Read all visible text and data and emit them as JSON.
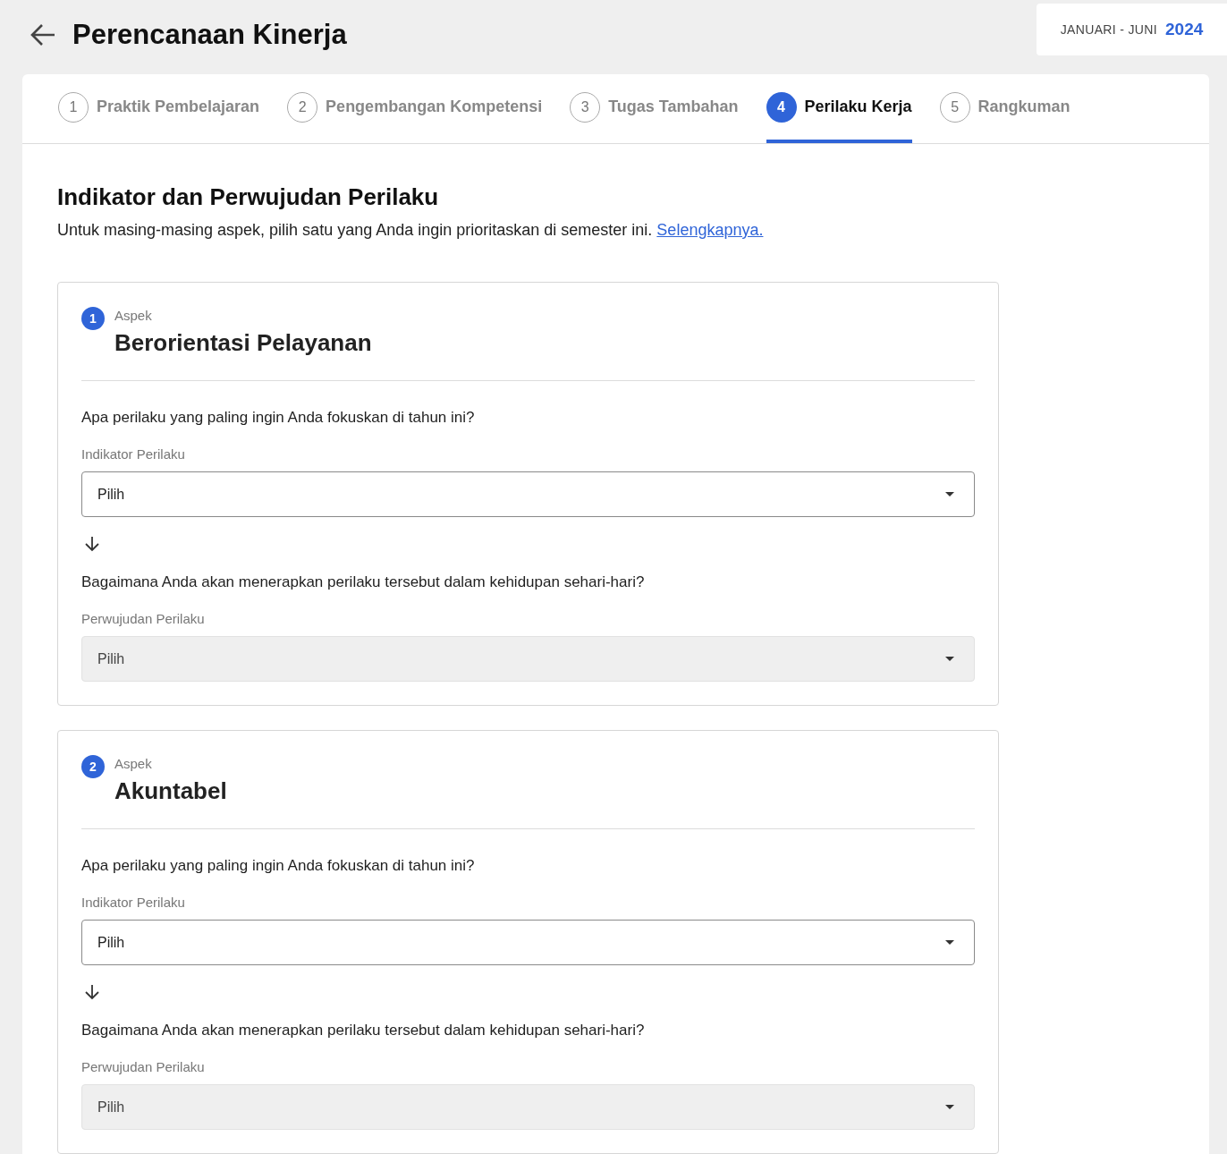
{
  "header": {
    "title": "Perencanaan Kinerja",
    "period": {
      "range": "JANUARI - JUNI",
      "year": "2024"
    }
  },
  "tabs": [
    {
      "number": "1",
      "label": "Praktik Pembelajaran",
      "selected": false
    },
    {
      "number": "2",
      "label": "Pengembangan Kompetensi",
      "selected": false
    },
    {
      "number": "3",
      "label": "Tugas Tambahan",
      "selected": false
    },
    {
      "number": "4",
      "label": "Perilaku Kerja",
      "selected": true
    },
    {
      "number": "5",
      "label": "Rangkuman",
      "selected": false
    }
  ],
  "section": {
    "title": "Indikator dan Perwujudan Perilaku",
    "description": "Untuk masing-masing aspek, pilih satu yang Anda ingin prioritaskan di semester ini.",
    "link": "Selengkapnya."
  },
  "aspects": [
    {
      "number": "1",
      "caption": "Aspek",
      "name": "Berorientasi Pelayanan",
      "questions": [
        {
          "question": "Apa perilaku yang paling ingin Anda fokuskan di tahun ini?",
          "label": "Indikator Perilaku",
          "placeholder": "Pilih",
          "disabled": false
        },
        {
          "question": "Bagaimana Anda akan menerapkan perilaku tersebut dalam kehidupan sehari-hari?",
          "label": "Perwujudan Perilaku",
          "placeholder": "Pilih",
          "disabled": true
        }
      ]
    },
    {
      "number": "2",
      "caption": "Aspek",
      "name": "Akuntabel",
      "questions": [
        {
          "question": "Apa perilaku yang paling ingin Anda fokuskan di tahun ini?",
          "label": "Indikator Perilaku",
          "placeholder": "Pilih",
          "disabled": false
        },
        {
          "question": "Bagaimana Anda akan menerapkan perilaku tersebut dalam kehidupan sehari-hari?",
          "label": "Perwujudan Perilaku",
          "placeholder": "Pilih",
          "disabled": true
        }
      ]
    }
  ]
}
